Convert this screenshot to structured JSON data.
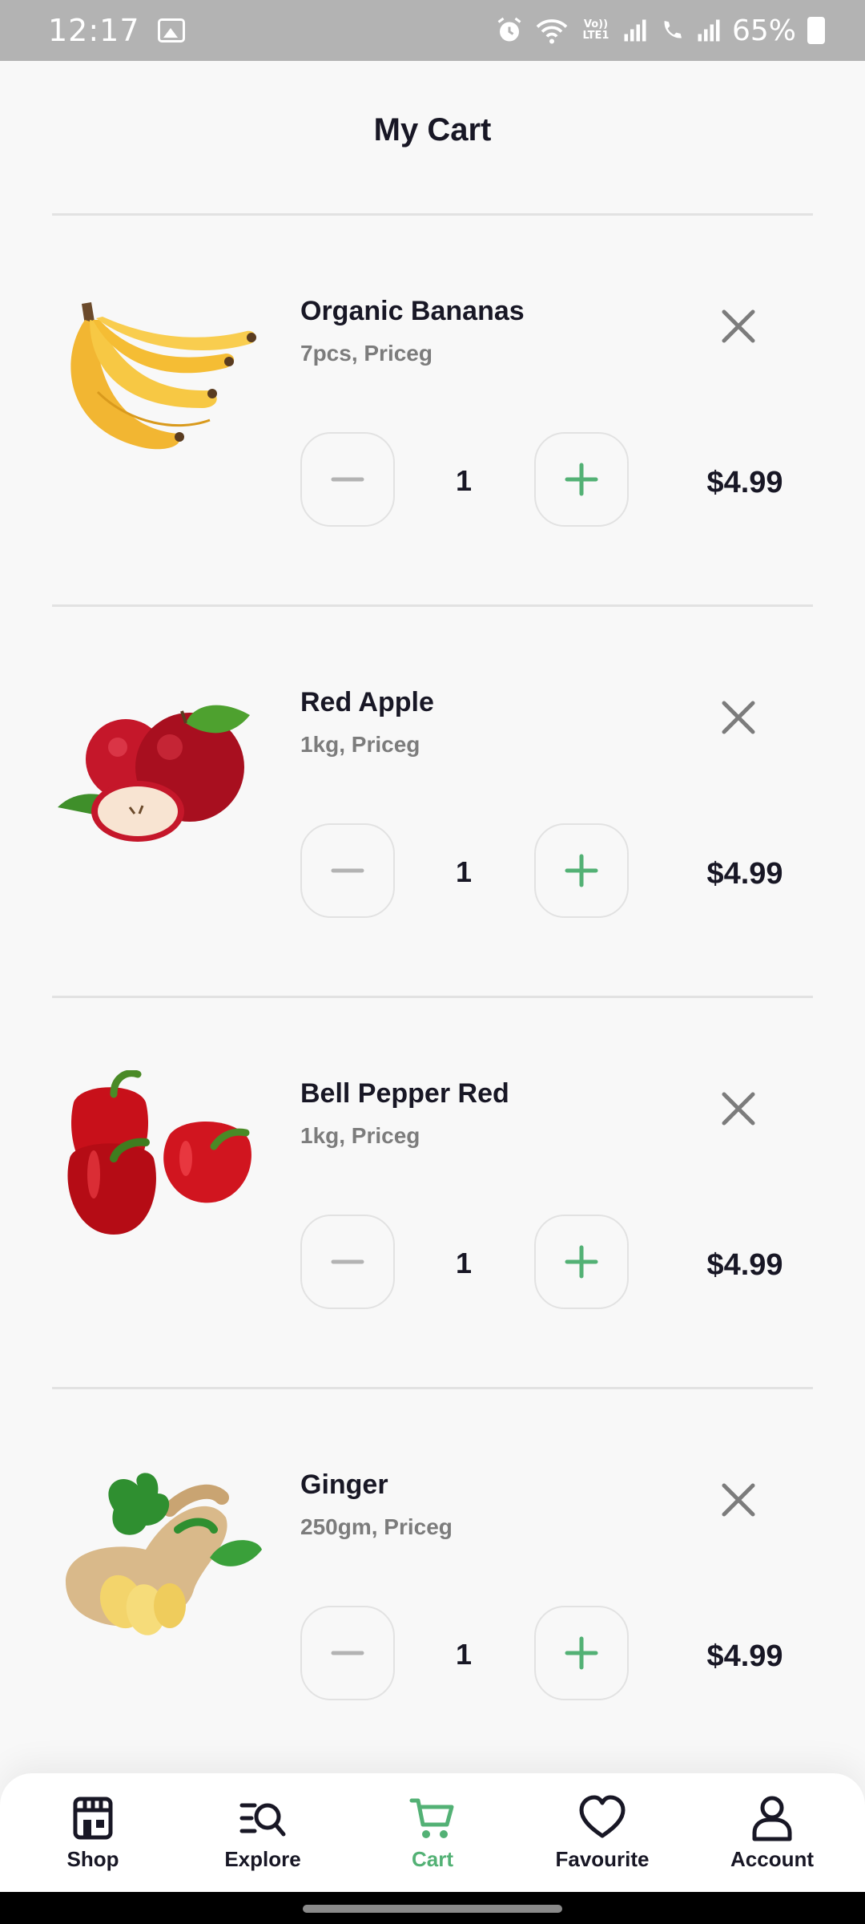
{
  "status_bar": {
    "time": "12:17",
    "battery": "65%",
    "icons": [
      "gallery-icon",
      "alarm-icon",
      "wifi-icon",
      "volte-icon",
      "signal-icon",
      "wifi-calling-icon",
      "signal-icon",
      "battery-icon"
    ],
    "volte_label": "Vo)) LTE1"
  },
  "header": {
    "title": "My Cart"
  },
  "cart": {
    "items": [
      {
        "name": "Organic Bananas",
        "desc": "7pcs, Priceg",
        "qty": "1",
        "price": "$4.99",
        "image": "bananas-image"
      },
      {
        "name": "Red Apple",
        "desc": "1kg, Priceg",
        "qty": "1",
        "price": "$4.99",
        "image": "red-apple-image"
      },
      {
        "name": "Bell Pepper Red",
        "desc": "1kg, Priceg",
        "qty": "1",
        "price": "$4.99",
        "image": "bell-pepper-image"
      },
      {
        "name": "Ginger",
        "desc": "250gm, Priceg",
        "qty": "1",
        "price": "$4.99",
        "image": "ginger-image"
      }
    ]
  },
  "nav": {
    "items": [
      {
        "label": "Shop",
        "icon": "store-icon",
        "active": false
      },
      {
        "label": "Explore",
        "icon": "explore-icon",
        "active": false
      },
      {
        "label": "Cart",
        "icon": "cart-icon",
        "active": true
      },
      {
        "label": "Favourite",
        "icon": "heart-icon",
        "active": false
      },
      {
        "label": "Account",
        "icon": "user-icon",
        "active": false
      }
    ]
  },
  "colors": {
    "accent": "#53B175",
    "text": "#181725",
    "muted": "#7C7C7C",
    "divider": "#E2E2E2",
    "background": "#F8F8F8"
  }
}
